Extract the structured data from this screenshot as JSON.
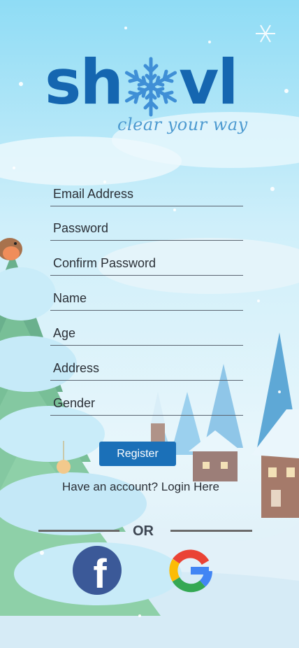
{
  "logo": {
    "word_left": "sh",
    "word_right": "vl",
    "tagline": "clear your way"
  },
  "form": {
    "fields": [
      {
        "label": "Email Address"
      },
      {
        "label": "Password"
      },
      {
        "label": "Confirm Password"
      },
      {
        "label": "Name"
      },
      {
        "label": "Age"
      },
      {
        "label": "Address"
      },
      {
        "label": "Gender"
      }
    ],
    "register_label": "Register",
    "login_prompt": "Have an account? Login Here"
  },
  "divider": {
    "or_label": "OR"
  },
  "social": [
    {
      "icon": "facebook-icon",
      "glyph": "f"
    },
    {
      "icon": "google-icon"
    }
  ],
  "colors": {
    "primary": "#1b70b8",
    "brand": "#1566b0",
    "sky": "#bfe7f8"
  }
}
